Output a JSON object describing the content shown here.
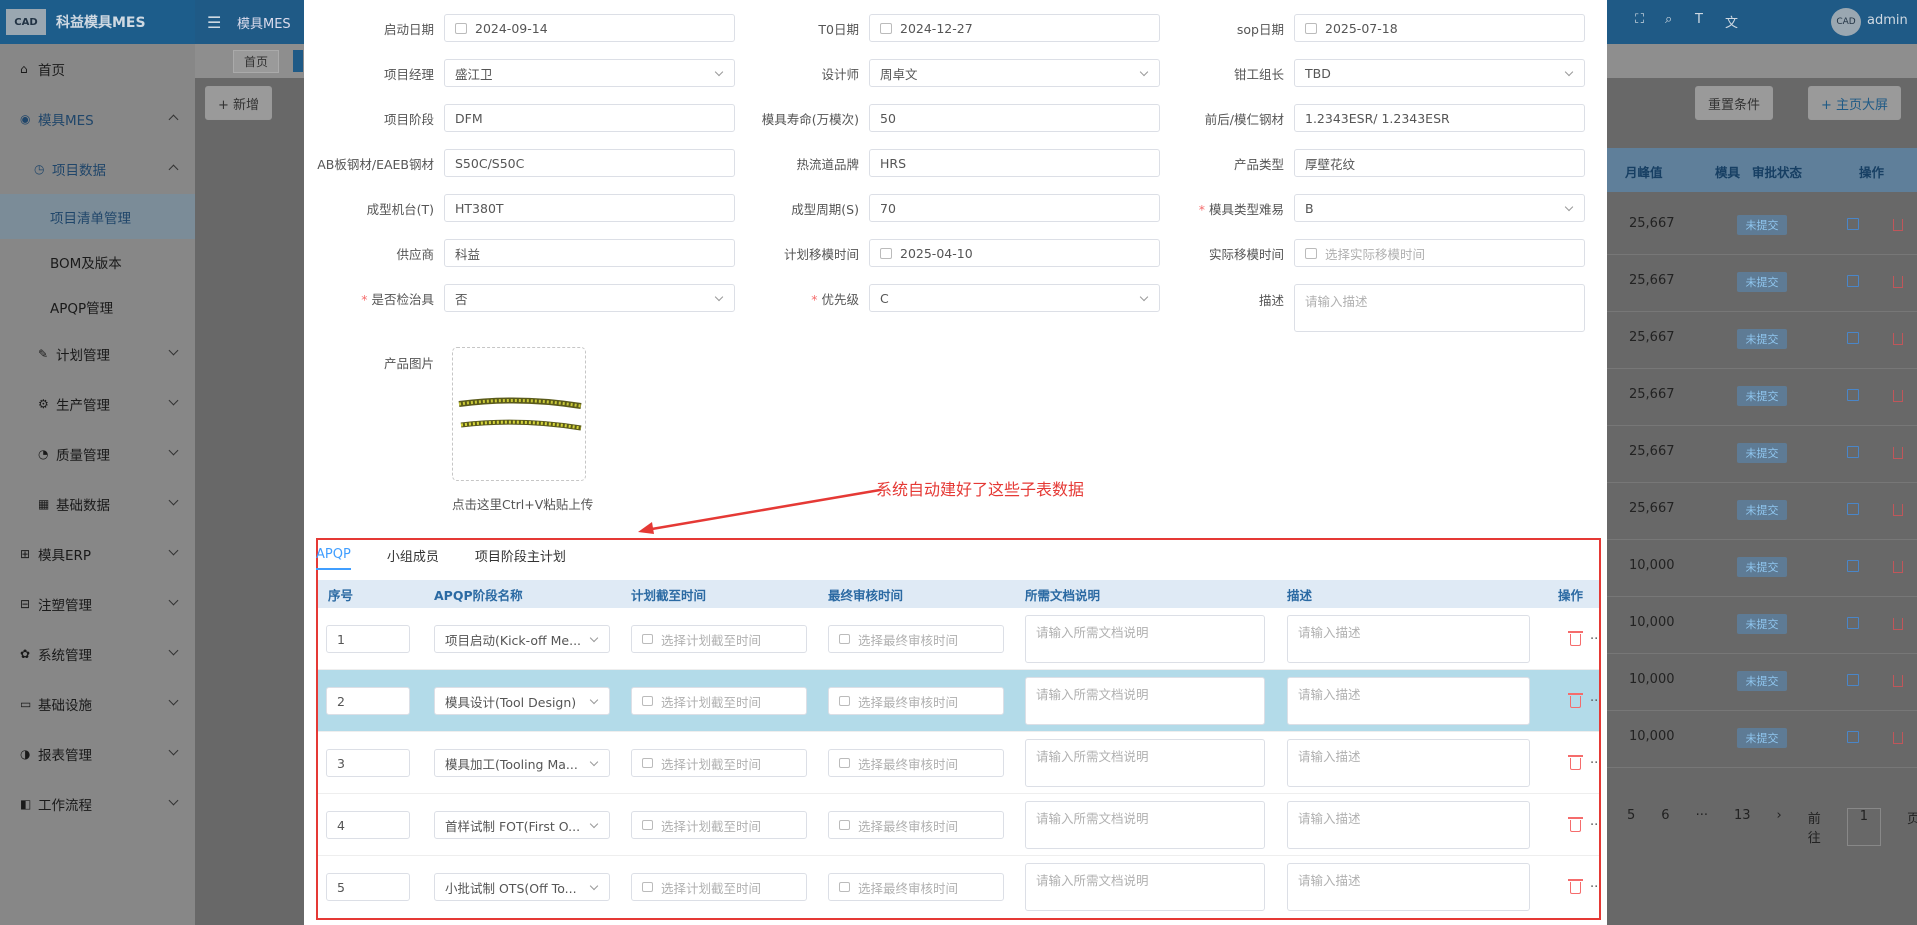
{
  "app": {
    "title": "科益模具MES",
    "logo_text": "CAD",
    "user": "admin"
  },
  "sidebar": {
    "items": [
      {
        "label": "首页",
        "icon": "home-icon"
      },
      {
        "label": "模具MES",
        "icon": "mes-icon"
      },
      {
        "label": "项目数据",
        "icon": "project-icon"
      },
      {
        "label": "项目清单管理"
      },
      {
        "label": "BOM及版本"
      },
      {
        "label": "APQP管理"
      },
      {
        "label": "计划管理",
        "icon": "plan-icon"
      },
      {
        "label": "生产管理",
        "icon": "production-icon"
      },
      {
        "label": "质量管理",
        "icon": "quality-icon"
      },
      {
        "label": "基础数据",
        "icon": "data-icon"
      },
      {
        "label": "模具ERP",
        "icon": "erp-icon"
      },
      {
        "label": "注塑管理",
        "icon": "injection-icon"
      },
      {
        "label": "系统管理",
        "icon": "system-icon"
      },
      {
        "label": "基础设施",
        "icon": "infra-icon"
      },
      {
        "label": "报表管理",
        "icon": "report-icon"
      },
      {
        "label": "工作流程",
        "icon": "workflow-icon"
      }
    ]
  },
  "topbar": {
    "tab_home": "首页",
    "tab_mold": "模具MES"
  },
  "toolbar": {
    "add_label": "+ 新增",
    "reset_label": "重置条件",
    "bigscreen_label": "+ 主页大屏"
  },
  "list_table": {
    "headers": {
      "peak": "月峰值",
      "mold": "模具",
      "status": "审批状态",
      "ops": "操作"
    },
    "rows": [
      {
        "peak": "25,667",
        "status": "未提交"
      },
      {
        "peak": "25,667",
        "status": "未提交"
      },
      {
        "peak": "25,667",
        "status": "未提交"
      },
      {
        "peak": "25,667",
        "status": "未提交"
      },
      {
        "peak": "25,667",
        "status": "未提交"
      },
      {
        "peak": "25,667",
        "status": "未提交"
      },
      {
        "peak": "10,000",
        "status": "未提交"
      },
      {
        "peak": "10,000",
        "status": "未提交"
      },
      {
        "peak": "10,000",
        "status": "未提交"
      },
      {
        "peak": "10,000",
        "status": "未提交"
      }
    ]
  },
  "pagination": {
    "pages": [
      "5",
      "6",
      "···",
      "13"
    ],
    "goto_label": "前往",
    "goto_value": "1",
    "page_suffix": "页"
  },
  "form": {
    "start_date": {
      "label": "启动日期",
      "value": "2024-09-14"
    },
    "t0_date": {
      "label": "T0日期",
      "value": "2024-12-27"
    },
    "sop_date": {
      "label": "sop日期",
      "value": "2025-07-18"
    },
    "pm": {
      "label": "项目经理",
      "value": "盛江卫"
    },
    "designer": {
      "label": "设计师",
      "value": "周卓文"
    },
    "fitter_lead": {
      "label": "钳工组长",
      "value": "TBD"
    },
    "stage": {
      "label": "项目阶段",
      "value": "DFM"
    },
    "mold_life": {
      "label": "模具寿命(万模次)",
      "value": "50"
    },
    "core_steel": {
      "label": "前后/模仁钢材",
      "value": "1.2343ESR/ 1.2343ESR"
    },
    "plate_steel": {
      "label": "AB板钢材/EAEB钢材",
      "value": "S50C/S50C"
    },
    "hot_runner": {
      "label": "热流道品牌",
      "value": "HRS"
    },
    "product_type": {
      "label": "产品类型",
      "value": "厚壁花纹"
    },
    "machine": {
      "label": "成型机台(T)",
      "value": "HT380T"
    },
    "cycle": {
      "label": "成型周期(S)",
      "value": "70"
    },
    "difficulty": {
      "label": "模具类型难易",
      "value": "B"
    },
    "supplier": {
      "label": "供应商",
      "value": "科益"
    },
    "plan_move": {
      "label": "计划移模时间",
      "value": "2025-04-10"
    },
    "actual_move": {
      "label": "实际移模时间",
      "placeholder": "选择实际移模时间"
    },
    "fixture": {
      "label": "是否检治具",
      "value": "否"
    },
    "priority": {
      "label": "优先级",
      "value": "C"
    },
    "desc": {
      "label": "描述",
      "placeholder": "请输入描述"
    },
    "image": {
      "label": "产品图片",
      "hint": "点击这里Ctrl+V粘贴上传"
    }
  },
  "annotation": "系统自动建好了这些子表数据",
  "subtable": {
    "tabs": [
      "APQP",
      "小组成员",
      "项目阶段主计划"
    ],
    "headers": {
      "seq": "序号",
      "stage": "APQP阶段名称",
      "plan": "计划截至时间",
      "review": "最终审核时间",
      "doc": "所需文档说明",
      "desc": "描述",
      "ops": "操作"
    },
    "placeholders": {
      "plan": "选择计划截至时间",
      "review": "选择最终审核时间",
      "doc": "请输入所需文档说明",
      "desc": "请输入描述"
    },
    "rows": [
      {
        "seq": "1",
        "stage": "项目启动(Kick-off Me..."
      },
      {
        "seq": "2",
        "stage": "模具设计(Tool Design)"
      },
      {
        "seq": "3",
        "stage": "模具加工(Tooling Ma..."
      },
      {
        "seq": "4",
        "stage": "首样试制 FOT(First O..."
      },
      {
        "seq": "5",
        "stage": "小批试制 OTS(Off To..."
      }
    ]
  },
  "colors": {
    "accent": "#409eff",
    "annotation": "#e53935",
    "topbar": "#1f5a86",
    "highlight_row": "#b3dbe9"
  }
}
